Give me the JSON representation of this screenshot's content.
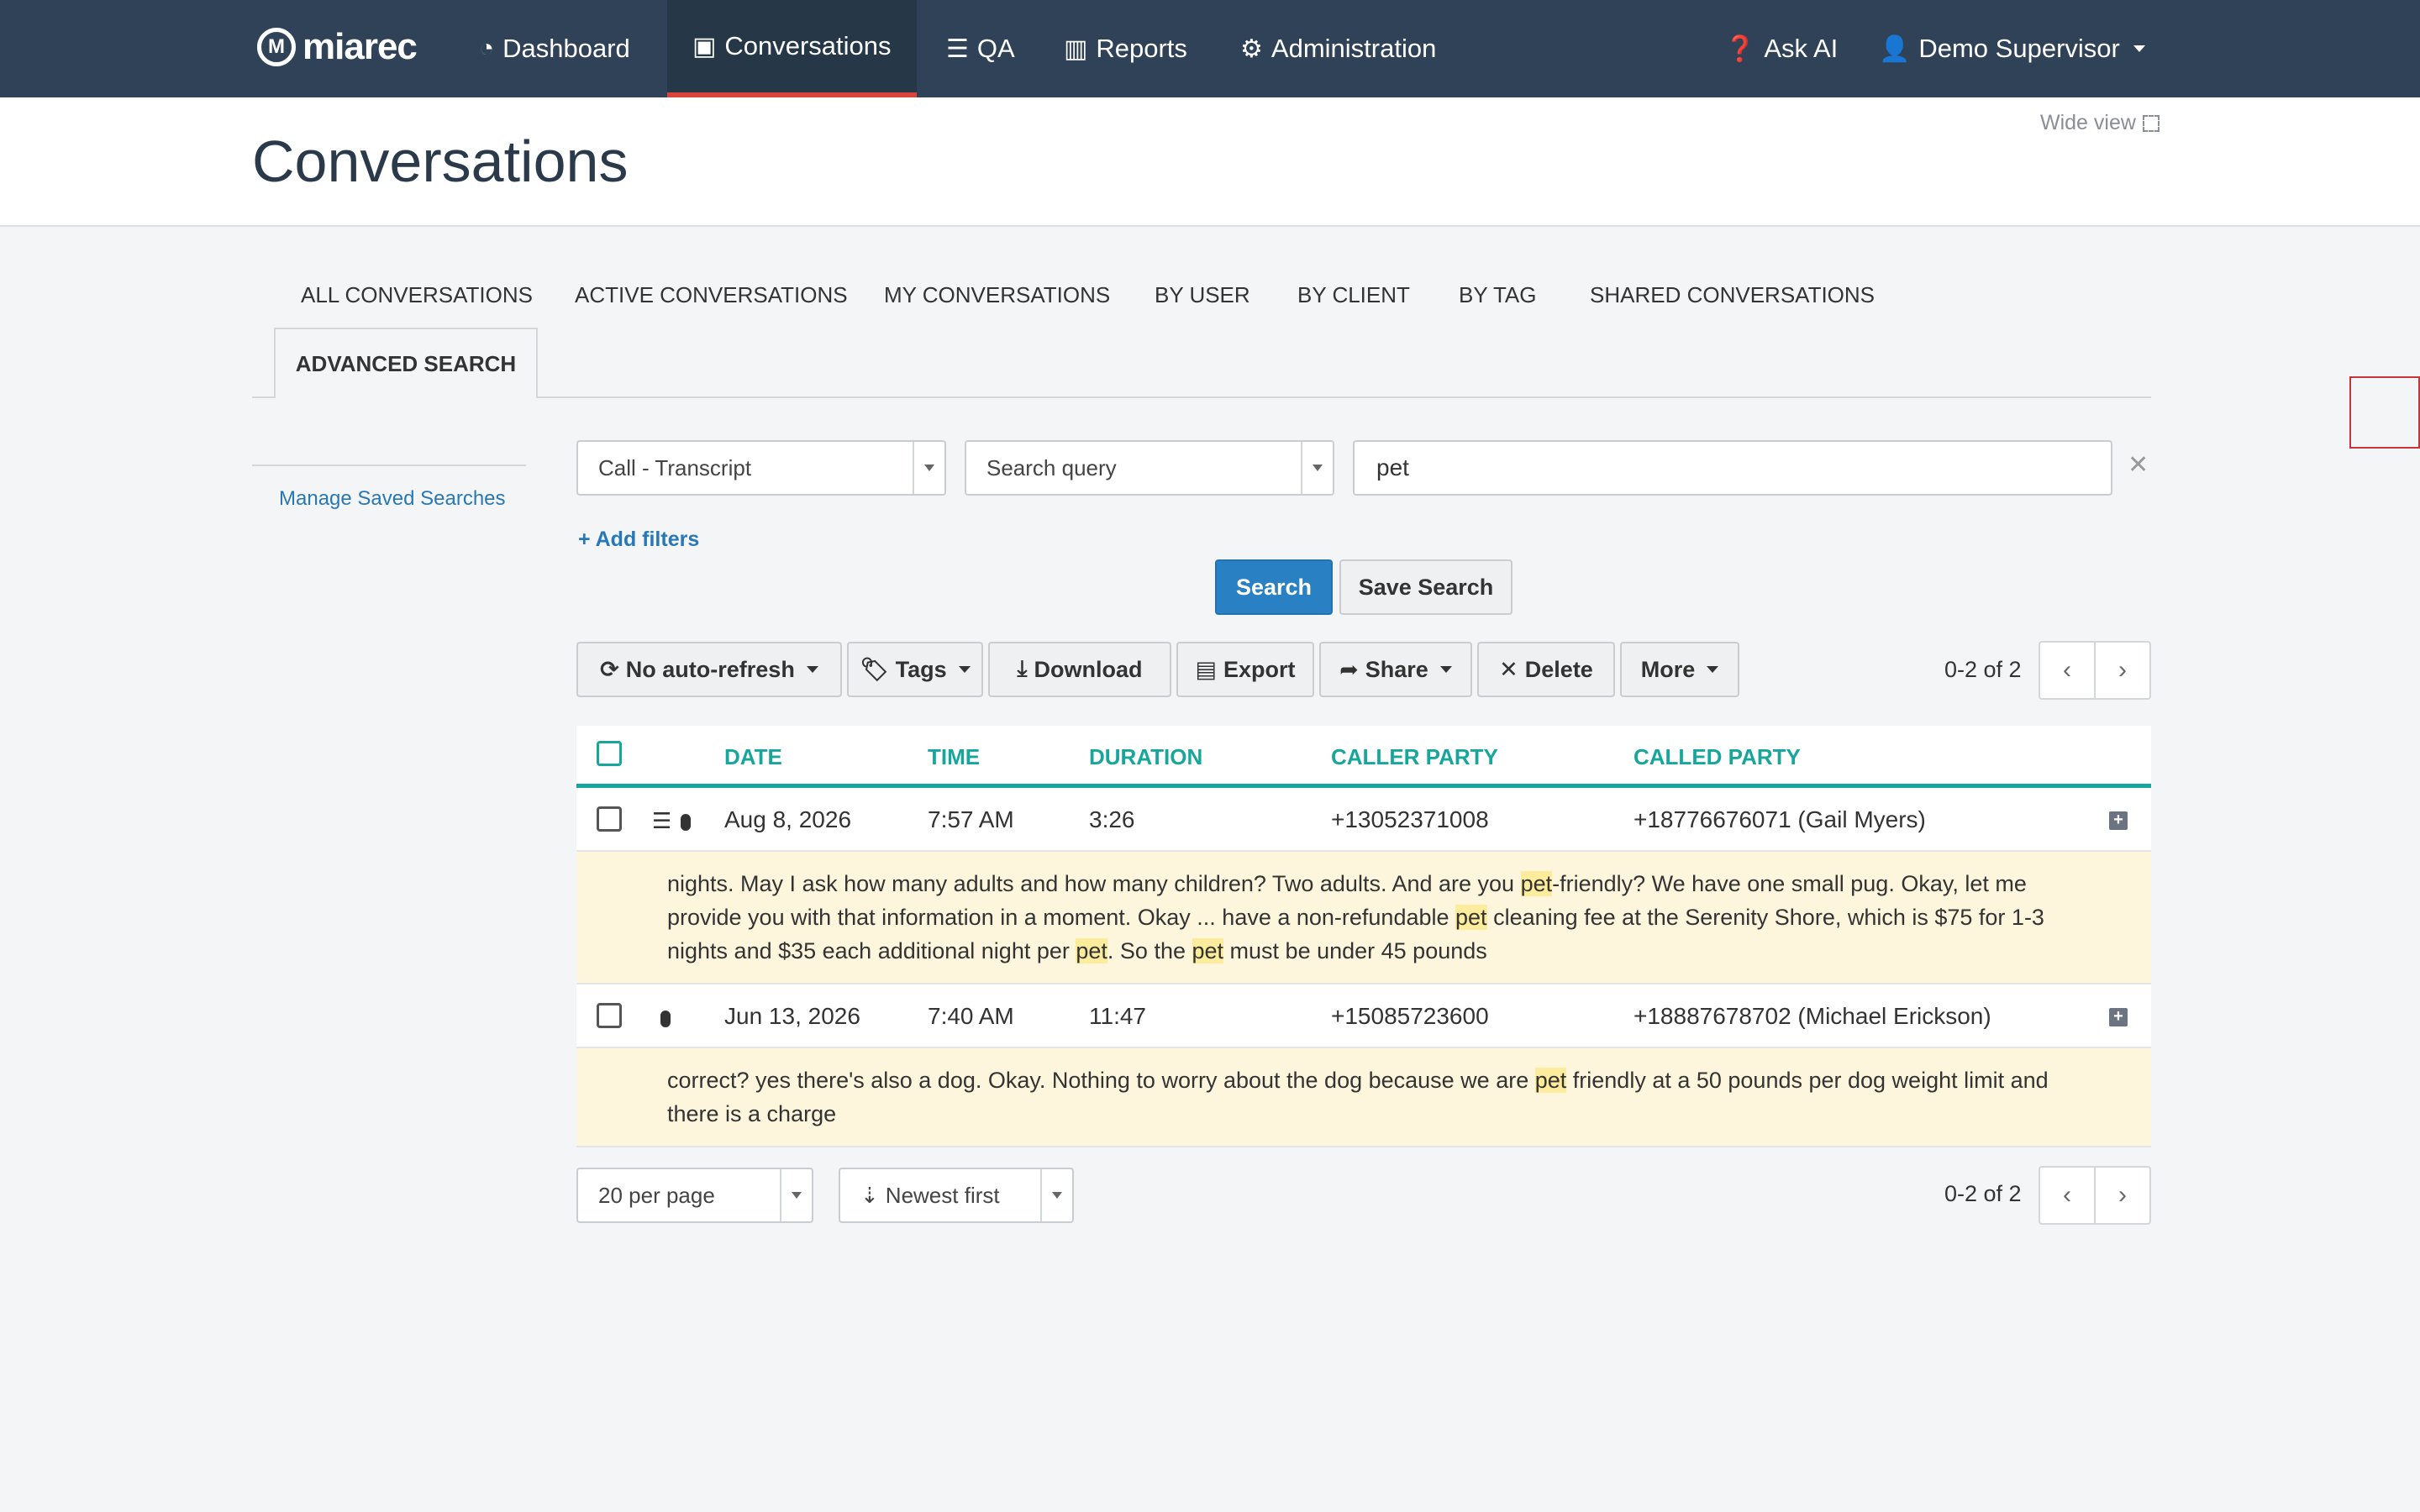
{
  "nav": {
    "logo_text": "miarec",
    "items": [
      {
        "label": "Dashboard",
        "icon": "dashboard-icon"
      },
      {
        "label": "Conversations",
        "icon": "play-square-icon"
      },
      {
        "label": "QA",
        "icon": "list-icon"
      },
      {
        "label": "Reports",
        "icon": "bar-chart-icon"
      },
      {
        "label": "Administration",
        "icon": "gear-icon"
      }
    ],
    "ask_ai": "Ask AI",
    "user": "Demo Supervisor",
    "active_color": "#d9443c"
  },
  "page": {
    "title": "Conversations",
    "wide_view": "Wide view"
  },
  "tabs": [
    "ALL CONVERSATIONS",
    "ACTIVE CONVERSATIONS",
    "MY CONVERSATIONS",
    "BY USER",
    "BY CLIENT",
    "BY TAG",
    "SHARED CONVERSATIONS"
  ],
  "active_tab": "ADVANCED SEARCH",
  "side": {
    "manage_saved": "Manage Saved Searches"
  },
  "search": {
    "type": "Call - Transcript",
    "field": "Search query",
    "query": "pet",
    "add_filters": "+ Add filters",
    "search_btn": "Search",
    "save_btn": "Save Search"
  },
  "toolbar": {
    "refresh": "No auto-refresh",
    "tags": "Tags",
    "download": "Download",
    "export": "Export",
    "share": "Share",
    "delete": "Delete",
    "more": "More"
  },
  "pagination": {
    "range": "0-2 of 2"
  },
  "table": {
    "headers": [
      "DATE",
      "TIME",
      "DURATION",
      "CALLER PARTY",
      "CALLED PARTY"
    ],
    "rows": [
      {
        "date": "Aug 8, 2026",
        "time": "7:57 AM",
        "duration": "3:26",
        "caller": "+13052371008",
        "called": "+18776676071 (Gail Myers)",
        "snippet_parts": [
          "nights. May I ask how many adults and how many children? Two adults. And are you ",
          "pet",
          "-friendly? We have one small pug. Okay, let me provide you with that information in a moment. Okay ... have a non-refundable ",
          "pet",
          " cleaning fee at the Serenity Shore, which is $75 for 1-3 nights and $35 each additional night per ",
          "pet",
          ". So the ",
          "pet",
          " must be under 45 pounds"
        ]
      },
      {
        "date": "Jun 13, 2026",
        "time": "7:40 AM",
        "duration": "11:47",
        "caller": "+15085723600",
        "called": "+18887678702 (Michael Erickson)",
        "snippet_parts": [
          "correct? yes there's also a dog. Okay. Nothing to worry about the dog because we are ",
          "pet",
          " friendly at a 50 pounds per dog weight limit and there is a charge"
        ]
      }
    ]
  },
  "footer": {
    "per_page": "20 per page",
    "sort": "Newest first"
  },
  "colors": {
    "nav_bg": "#2f4257",
    "accent": "#17a69b",
    "primary": "#2980c2",
    "highlight": "#fcec9c",
    "snippet_bg": "#fdf6dd"
  }
}
